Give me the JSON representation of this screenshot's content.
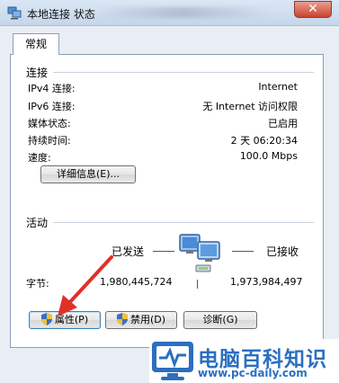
{
  "window": {
    "title": "本地连接 状态",
    "close_symbol": "✕"
  },
  "tabs": [
    {
      "label": "常规"
    }
  ],
  "connection": {
    "heading": "连接",
    "rows": [
      {
        "label": "IPv4 连接:",
        "value": "Internet"
      },
      {
        "label": "IPv6 连接:",
        "value": "无 Internet 访问权限"
      },
      {
        "label": "媒体状态:",
        "value": "已启用"
      },
      {
        "label": "持续时间:",
        "value": "2 天 06:20:34"
      },
      {
        "label": "速度:",
        "value": "100.0 Mbps"
      }
    ],
    "details_button": "详细信息(E)..."
  },
  "activity": {
    "heading": "活动",
    "sent_label": "已发送",
    "received_label": "已接收",
    "bytes_label": "字节:",
    "bytes_sent": "1,980,445,724",
    "bytes_received": "1,973,984,497"
  },
  "buttons": {
    "properties": "属性(P)",
    "disable": "禁用(D)",
    "diagnose": "诊断(G)"
  },
  "watermark": {
    "title": "电脑百科知识",
    "url": "www.pc-daily.com"
  },
  "colors": {
    "accent": "#2b6fc0",
    "arrow": "#e0302a",
    "panel_border": "#8a9fb8"
  }
}
